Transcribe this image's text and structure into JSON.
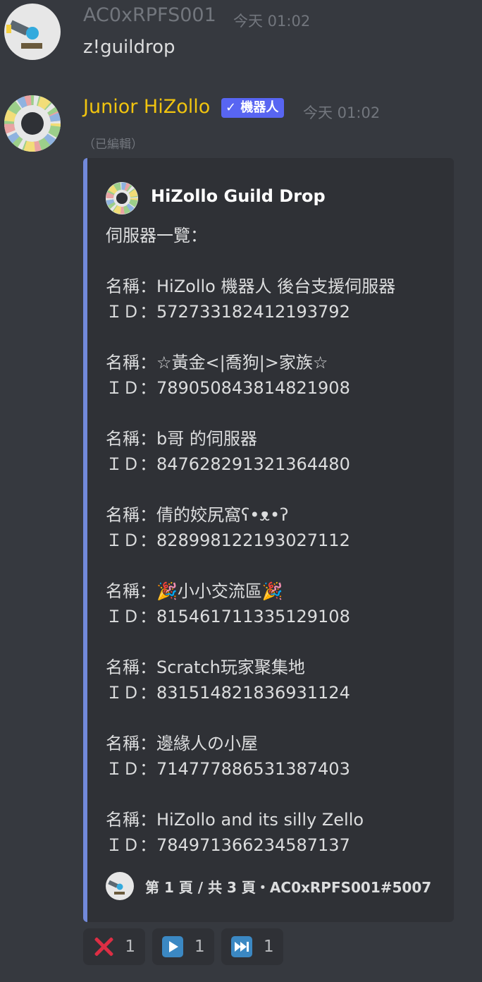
{
  "messages": [
    {
      "author": "AC0xRPFS001",
      "author_color": "#72767d",
      "timestamp": "今天 01:02",
      "content": "z!guildrop"
    },
    {
      "author": "Junior HiZollo",
      "author_color": "#f1c40f",
      "bot_tag": "✓ 機器人",
      "timestamp": "今天 01:02",
      "edited": "（已編輯）",
      "embed": {
        "color": "#7289da",
        "author_name": "HiZollo Guild Drop",
        "description_lines": [
          "伺服器一覽：",
          "",
          "名稱：HiZollo 機器人 後台支援伺服器",
          "ＩＤ：572733182412193792",
          "",
          "名稱：☆黃金<|喬狗|>家族☆",
          "ＩＤ：789050843814821908",
          "",
          "名稱：b哥 的伺服器",
          "ＩＤ：847628291321364480",
          "",
          "名稱：倩的姣尻窩ʕ•ᴥ•ʔ",
          "ＩＤ：828998122193027112",
          "",
          "名稱：🎉小小交流區🎉",
          "ＩＤ：815461711335129108",
          "",
          "名稱：Scratch玩家聚集地",
          "ＩＤ：831514821836931124",
          "",
          "名稱：邊緣人の小屋",
          "ＩＤ：714777886531387403",
          "",
          "名稱：HiZollo and its silly Zello",
          "ＩＤ：784971366234587137"
        ],
        "footer": "第 1 頁 / 共 3 頁・AC0xRPFS001#5007"
      }
    }
  ],
  "reactions": [
    {
      "emoji": "x-mark-icon",
      "count": "1"
    },
    {
      "emoji": "play-button-icon",
      "count": "1"
    },
    {
      "emoji": "next-track-icon",
      "count": "1"
    }
  ]
}
